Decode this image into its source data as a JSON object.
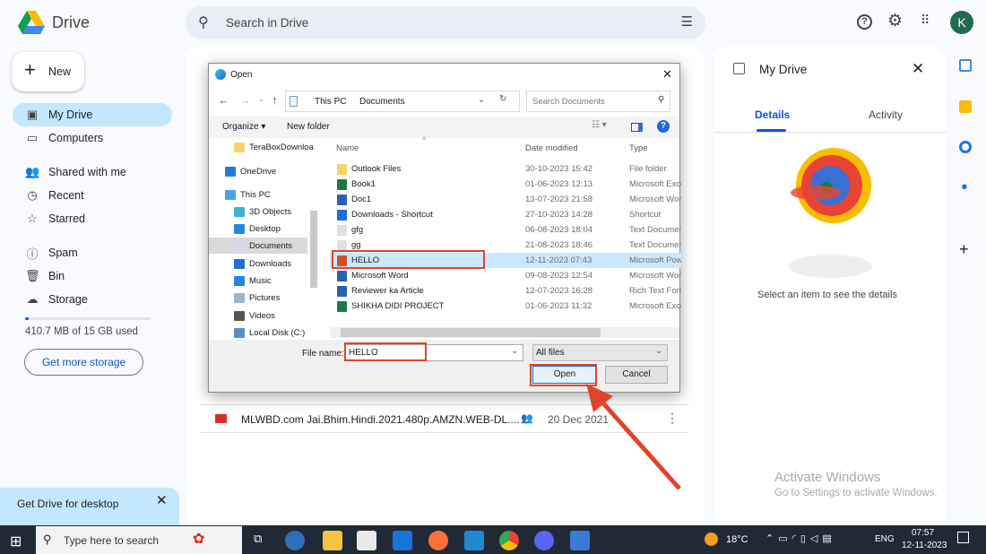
{
  "header": {
    "app_name": "Drive",
    "search_placeholder": "Search in Drive",
    "avatar_letter": "K"
  },
  "sidebar": {
    "new_label": "New",
    "items": [
      {
        "label": "My Drive",
        "icon": "my-drive-icon",
        "active": true
      },
      {
        "label": "Computers",
        "icon": "computers-icon"
      },
      {
        "label": "Shared with me",
        "icon": "shared-icon"
      },
      {
        "label": "Recent",
        "icon": "clock-icon"
      },
      {
        "label": "Starred",
        "icon": "star-icon"
      },
      {
        "label": "Spam",
        "icon": "spam-icon"
      },
      {
        "label": "Bin",
        "icon": "bin-icon"
      },
      {
        "label": "Storage",
        "icon": "cloud-icon"
      }
    ],
    "storage_used_text": "410.7 MB of 15 GB used",
    "storage_fraction": 0.027,
    "get_storage_label": "Get more storage",
    "promo": {
      "title": "Get Drive for desktop"
    }
  },
  "main": {
    "file_row": {
      "name": "MLWBD.com Jai.Bhim.Hindi.2021.480p.AMZN.WEB-DL....",
      "date": "20 Dec 2021"
    }
  },
  "details_panel": {
    "title": "My Drive",
    "tabs": [
      "Details",
      "Activity"
    ],
    "active_tab": "Details",
    "empty_text": "Select an item to see the details"
  },
  "watermark": {
    "title": "Activate Windows",
    "subtitle": "Go to Settings to activate Windows."
  },
  "dialog": {
    "title": "Open",
    "breadcrumb": [
      "This PC",
      "Documents"
    ],
    "search_placeholder": "Search Documents",
    "organize_label": "Organize",
    "new_folder_label": "New folder",
    "nav": [
      {
        "label": "TeraBoxDownloa",
        "color": "#f6d36b"
      },
      {
        "label": "OneDrive",
        "color": "#1f7be0"
      },
      {
        "label": "This PC",
        "color": "#4aa3e8"
      },
      {
        "label": "3D Objects",
        "color": "#3ab4d6"
      },
      {
        "label": "Desktop",
        "color": "#1e88e5"
      },
      {
        "label": "Documents",
        "color": "#cfd8e3",
        "selected": true
      },
      {
        "label": "Downloads",
        "color": "#1e6fd6"
      },
      {
        "label": "Music",
        "color": "#1e88e5"
      },
      {
        "label": "Pictures",
        "color": "#9fb4c8"
      },
      {
        "label": "Videos",
        "color": "#555"
      },
      {
        "label": "Local Disk (C:)",
        "color": "#5a8fc4"
      }
    ],
    "columns": [
      "Name",
      "Date modified",
      "Type"
    ],
    "files": [
      {
        "name": "Outlook Files",
        "date": "30-10-2023 15:42",
        "type": "File folder",
        "color": "#f6d36b"
      },
      {
        "name": "Book1",
        "date": "01-06-2023 12:13",
        "type": "Microsoft Excel",
        "color": "#1d7a45"
      },
      {
        "name": "Doc1",
        "date": "13-07-2023 21:58",
        "type": "Microsoft Word",
        "color": "#2b5fb4"
      },
      {
        "name": "Downloads - Shortcut",
        "date": "27-10-2023 14:28",
        "type": "Shortcut",
        "color": "#1e6fd6"
      },
      {
        "name": "gfg",
        "date": "06-08-2023 18:04",
        "type": "Text Document",
        "color": "#e0e0e0"
      },
      {
        "name": "gg",
        "date": "21-08-2023 18:46",
        "type": "Text Document",
        "color": "#e0e0e0"
      },
      {
        "name": "HELLO",
        "date": "12-11-2023 07:43",
        "type": "Microsoft PowerPoint",
        "color": "#d2502b",
        "selected": true
      },
      {
        "name": "Microsoft Word",
        "date": "09-08-2023 12:54",
        "type": "Microsoft Word",
        "color": "#2b5fb4"
      },
      {
        "name": "Reviewer ka Article",
        "date": "12-07-2023 16:28",
        "type": "Rich Text Format",
        "color": "#2b5fb4"
      },
      {
        "name": "SHIKHA DIDI PROJECT",
        "date": "01-06-2023 11:32",
        "type": "Microsoft Excel",
        "color": "#1d7a45"
      }
    ],
    "file_name_label": "File name:",
    "file_name_value": "HELLO",
    "filter_value": "All files",
    "open_label": "Open",
    "cancel_label": "Cancel"
  },
  "taskbar": {
    "search_placeholder": "Type here to search",
    "weather": "18°C",
    "language": "ENG",
    "time": "07:57",
    "date": "12-11-2023"
  },
  "colors": {
    "accent": "#0b57d0",
    "highlight": "#e0442a",
    "selected_nav": "#c2e7ff"
  }
}
